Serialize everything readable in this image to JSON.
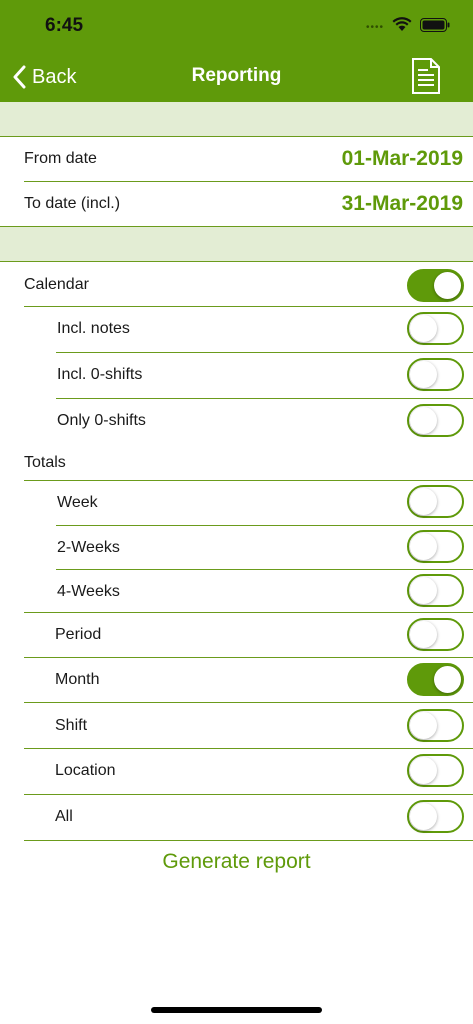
{
  "status": {
    "time": "6:45",
    "dots": "••••"
  },
  "nav": {
    "back_label": "Back",
    "title": "Reporting"
  },
  "dates": {
    "from_label": "From date",
    "from_value": "01-Mar-2019",
    "to_label": "To date (incl.)",
    "to_value": "31-Mar-2019"
  },
  "calendar": {
    "label": "Calendar",
    "on": true,
    "incl_notes": {
      "label": "Incl. notes",
      "on": false
    },
    "incl_zero_shifts": {
      "label": "Incl. 0-shifts",
      "on": false
    },
    "only_zero_shifts": {
      "label": "Only 0-shifts",
      "on": false
    }
  },
  "totals": {
    "label": "Totals",
    "week": {
      "label": "Week",
      "on": false
    },
    "two_weeks": {
      "label": "2-Weeks",
      "on": false
    },
    "four_weeks": {
      "label": "4-Weeks",
      "on": false
    },
    "period": {
      "label": "Period",
      "on": false
    },
    "month": {
      "label": "Month",
      "on": true
    },
    "shift": {
      "label": "Shift",
      "on": false
    },
    "location": {
      "label": "Location",
      "on": false
    },
    "all": {
      "label": "All",
      "on": false
    }
  },
  "actions": {
    "generate_label": "Generate report"
  },
  "colors": {
    "accent": "#5f9a0a",
    "band": "#e3edd4"
  }
}
